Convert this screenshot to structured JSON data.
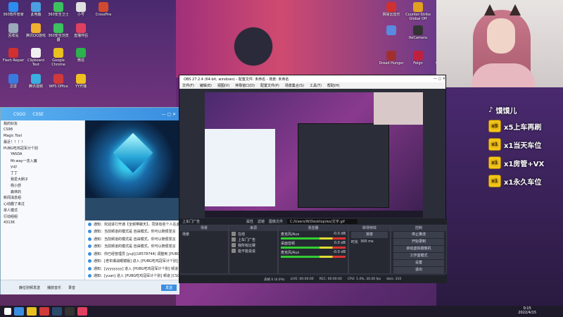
{
  "desktop": {
    "icons": [
      {
        "label": "360软件管家",
        "color": "#2d8cf0"
      },
      {
        "label": "此电脑",
        "color": "#4aa0e0"
      },
      {
        "label": "360安全卫士",
        "color": "#3cc060"
      },
      {
        "label": "小号",
        "color": "#e0e0e0"
      },
      {
        "label": "CrossFire",
        "color": "#d04a30"
      },
      {
        "label": "回收站",
        "color": "#9ab"
      },
      {
        "label": "腾讯QQ游戏",
        "color": "#f0b030"
      },
      {
        "label": "360安全浏览器",
        "color": "#3cc060"
      },
      {
        "label": "直播伴侣",
        "color": "#e04060"
      },
      {
        "label": "Flash Repair",
        "color": "#d03030"
      },
      {
        "label": "Clipboard Text",
        "color": "#f0f0f0"
      },
      {
        "label": "Google Chrome",
        "color": "#e8c020"
      },
      {
        "label": "微信",
        "color": "#2bb24c"
      },
      {
        "label": "迅雷",
        "color": "#3a7ae0"
      },
      {
        "label": "腾讯视频",
        "color": "#3ab0e0"
      },
      {
        "label": "WPS Office",
        "color": "#d03a3a"
      },
      {
        "label": "YY开播",
        "color": "#f0c020"
      }
    ],
    "right_icons": [
      {
        "label": "网易云音乐",
        "color": "#d03030"
      },
      {
        "label": "Counter-Strike Global Off",
        "color": "#e0a020"
      },
      {
        "label": "",
        "color": "#5a8ae0"
      },
      {
        "label": "ReCamera",
        "color": "#333"
      },
      {
        "label": "Dread Hunger",
        "color": "#a03030"
      },
      {
        "label": "Feign",
        "color": "#c02040"
      },
      {
        "label": "QQ音乐",
        "color": "#30c060"
      }
    ]
  },
  "side_list": {
    "title": "馍馍儿",
    "items": [
      {
        "badge": "x5",
        "text": "x5上车再刷"
      },
      {
        "badge": "x1",
        "text": "x1当天车位"
      },
      {
        "badge": "x1",
        "text": "x1房管+VX"
      },
      {
        "badge": "x1",
        "text": "x1永久车位"
      }
    ]
  },
  "qq": {
    "title_left": "CSGO",
    "title_mid": "CSSE",
    "groups": [
      "我的好友",
      "CS98",
      "Magic Tool",
      "最近！！！！",
      "PUBG吃鸡冠军计个别",
      "YAN3A",
      "Mr.way一念入魔",
      "yuji",
      "丁丁",
      "我爱大刷子",
      "杨小舒",
      "森林的"
    ],
    "folders": [
      "新闻消息组",
      "心动趣了来过",
      "单人模式",
      "行动组组",
      "4313K"
    ],
    "messages": [
      "通知：欢迎进行开通【全频带聊天】，同体有些个人在此开通",
      "通知：当前频道的模式是 自由模式，你可以随便发言",
      "通知：当前频道的模式是 自由模式，你可以随便发言",
      "通知：当前频道的模式是 自由模式，你可以随便发言",
      "通知：你已经管理员 [yuji](18578744) 调整到 [PUBG吃鸡冠军",
      "通知：[老年爆战眼镜版] 进入 [PUBG吃鸡冠军计个别]",
      "通知：[yyyyyyyy] 进入 [PUBG吃鸡冠军计个别] 频道",
      "通知：[yuan] 进入 [PUBG吃鸡冠军计个别] 频道 [CSOB]"
    ],
    "bottom": [
      "静位别频发送",
      "播放音乐",
      "录音"
    ],
    "send": "发送",
    "input_placeholder": "请输入..."
  },
  "obs": {
    "title": "OBS 27.2.4 (64-bit, windows) - 配置文件: 未命名 - 场景: 未命名",
    "menu": [
      "文件(F)",
      "编辑(E)",
      "视图(V)",
      "停靠窗口(D)",
      "配置文件(P)",
      "场景集合(S)",
      "工具(T)",
      "帮助(H)"
    ],
    "context_label": "上车门广告",
    "props": "属性",
    "filters": "滤镜",
    "image_file_label": "图像文件",
    "image_path": "C:/Users/W/Desktop/ws/文字.gif",
    "panels": {
      "scenes": "场景",
      "sources": "来源",
      "mixer": "混音器",
      "transitions": "转场特效",
      "controls": "控制"
    },
    "scene_items": [
      "场景"
    ],
    "source_items": [
      "在线",
      "上车门广告",
      "我所有比赛",
      "能不能说说"
    ],
    "mixer_items": [
      {
        "label": "麦克风/Aux",
        "db": "-0.0 dB"
      },
      {
        "label": "桌面音频",
        "db": "0.0 dB"
      },
      {
        "label": "麦克风/Aux",
        "db": "-0.0 dB"
      }
    ],
    "transition": {
      "type": "渐变",
      "duration_label": "时长",
      "duration": "300 ms"
    },
    "controls": [
      "停止推流",
      "开始录制",
      "启动虚拟摄像机",
      "工作室模式",
      "设置",
      "退出"
    ],
    "status": {
      "dropped": "丢帧 0 (0.0%)",
      "live": "LIVE: 00:00:00",
      "rec": "REC: 00:00:00",
      "cpu": "CPU: 1.4%, 30.00 fps",
      "kbps": "kb/s: 310"
    }
  },
  "taskbar": {
    "time": "0:15",
    "date": "2022/4/15"
  }
}
